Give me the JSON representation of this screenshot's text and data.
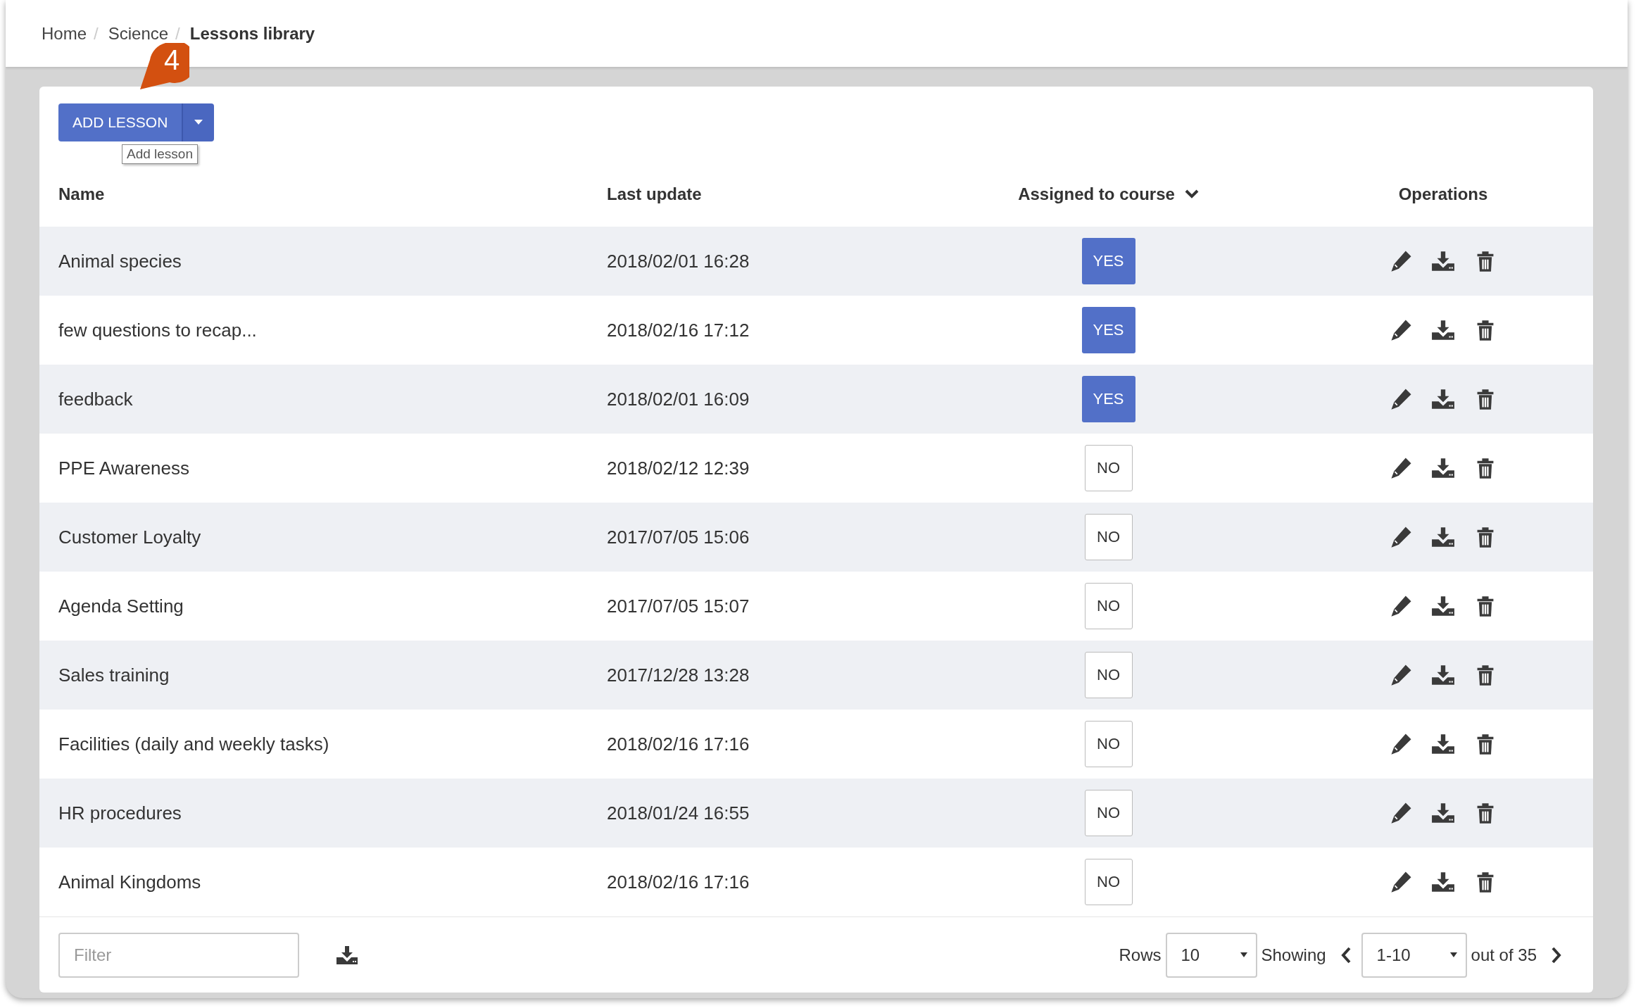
{
  "breadcrumb": [
    {
      "label": "Home",
      "current": false
    },
    {
      "separator_before": "/",
      "label": "Science",
      "current": false
    },
    {
      "separator_before": "/",
      "label": "Lessons library",
      "current": true
    }
  ],
  "callout": {
    "number": "4"
  },
  "add_button": {
    "label": "ADD LESSON",
    "tooltip": "Add lesson"
  },
  "table": {
    "columns": [
      {
        "label": "Name",
        "sorted": false
      },
      {
        "label": "Last update",
        "sorted": false
      },
      {
        "label": "Assigned to course",
        "sorted": true
      },
      {
        "label": "Operations",
        "sorted": false
      }
    ],
    "rows": [
      {
        "name": "Animal species",
        "last_update": "2018/02/01 16:28",
        "assigned": {
          "label": "YES",
          "on": true
        }
      },
      {
        "name": "few questions to recap...",
        "last_update": "2018/02/16 17:12",
        "assigned": {
          "label": "YES",
          "on": true
        }
      },
      {
        "name": "feedback",
        "last_update": "2018/02/01 16:09",
        "assigned": {
          "label": "YES",
          "on": true
        }
      },
      {
        "name": "PPE Awareness",
        "last_update": "2018/02/12 12:39",
        "assigned": {
          "label": "NO",
          "on": false
        }
      },
      {
        "name": "Customer Loyalty",
        "last_update": "2017/07/05 15:06",
        "assigned": {
          "label": "NO",
          "on": false
        }
      },
      {
        "name": "Agenda Setting",
        "last_update": "2017/07/05 15:07",
        "assigned": {
          "label": "NO",
          "on": false
        }
      },
      {
        "name": "Sales training",
        "last_update": "2017/12/28 13:28",
        "assigned": {
          "label": "NO",
          "on": false
        }
      },
      {
        "name": "Facilities (daily and weekly tasks)",
        "last_update": "2018/02/16 17:16",
        "assigned": {
          "label": "NO",
          "on": false
        }
      },
      {
        "name": "HR procedures",
        "last_update": "2018/01/24 16:55",
        "assigned": {
          "label": "NO",
          "on": false
        }
      },
      {
        "name": "Animal Kingdoms",
        "last_update": "2018/02/16 17:16",
        "assigned": {
          "label": "NO",
          "on": false
        }
      }
    ]
  },
  "footer": {
    "filter": {
      "placeholder": "Filter"
    },
    "rows_label": "Rows",
    "rows_select": "10",
    "showing_label": "Showing",
    "range_select": "1-10",
    "total": "out of 35"
  }
}
